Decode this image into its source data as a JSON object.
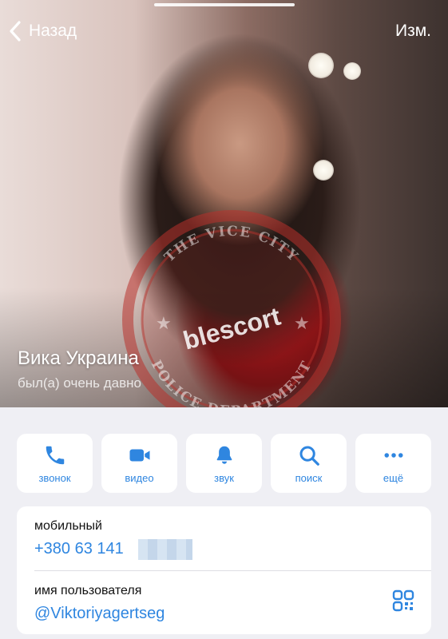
{
  "header": {
    "back_label": "Назад",
    "edit_label": "Изм."
  },
  "profile": {
    "name": "Вика Украина",
    "status": "был(а) очень давно"
  },
  "watermark": {
    "text": "blescort",
    "seal_top": "THE VICE CITY",
    "seal_bottom": "POLICE DEPARTMENT"
  },
  "actions": [
    {
      "label": "звонок",
      "icon": "phone-icon"
    },
    {
      "label": "видео",
      "icon": "video-camera-icon"
    },
    {
      "label": "звук",
      "icon": "bell-icon"
    },
    {
      "label": "поиск",
      "icon": "search-icon"
    },
    {
      "label": "ещё",
      "icon": "more-dots-icon"
    }
  ],
  "info": {
    "mobile_label": "мобильный",
    "mobile_value": "+380 63 141",
    "username_label": "имя пользователя",
    "username_value": "@Viktoriyagertseg"
  },
  "colors": {
    "accent": "#2f86e0",
    "background": "#efeff4",
    "card": "#ffffff",
    "seal": "#b8322c"
  }
}
